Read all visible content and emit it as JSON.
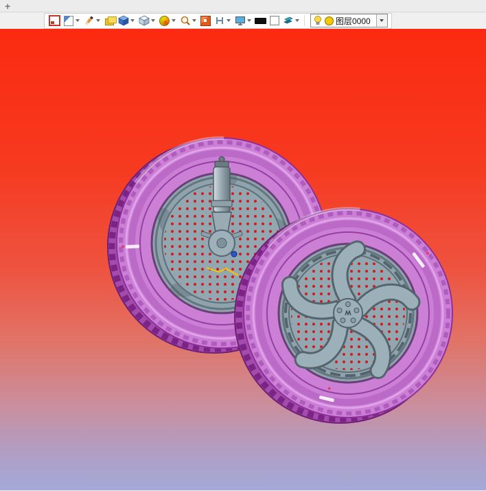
{
  "titlebar": {
    "plus": "+"
  },
  "toolbar": {
    "icons": [
      {
        "name": "new-view-icon",
        "dropdown": false
      },
      {
        "name": "document-icon",
        "dropdown": true
      },
      {
        "name": "pencil-icon",
        "dropdown": true
      },
      {
        "name": "layers-icon",
        "dropdown": false
      },
      {
        "name": "solid-cube-icon",
        "dropdown": true
      },
      {
        "name": "wire-cube-icon",
        "dropdown": true
      },
      {
        "name": "color-wheel-icon",
        "dropdown": true
      },
      {
        "name": "zoom-icon",
        "dropdown": true
      },
      {
        "name": "region-icon",
        "dropdown": false
      },
      {
        "name": "section-icon",
        "dropdown": true
      },
      {
        "name": "display-icon",
        "dropdown": true
      },
      {
        "name": "line-width-icon",
        "dropdown": false
      },
      {
        "name": "background-swatch-icon",
        "dropdown": false
      },
      {
        "name": "material-icon",
        "dropdown": true
      }
    ],
    "layer_selector": {
      "value": "图层0000"
    }
  },
  "viewport": {
    "background_top": "#fb2a10",
    "background_bottom": "#a3aad8",
    "objects": [
      {
        "name": "rear-wheel-assembly",
        "tire_color": "#cb80d6",
        "rim_color": "#93a7b1",
        "rotor_dot_color": "#d01f1f"
      },
      {
        "name": "front-wheel-assembly",
        "tire_color": "#cb80d6",
        "rim_color": "#9cb0ba",
        "rotor_dot_color": "#d01f1f"
      }
    ]
  }
}
